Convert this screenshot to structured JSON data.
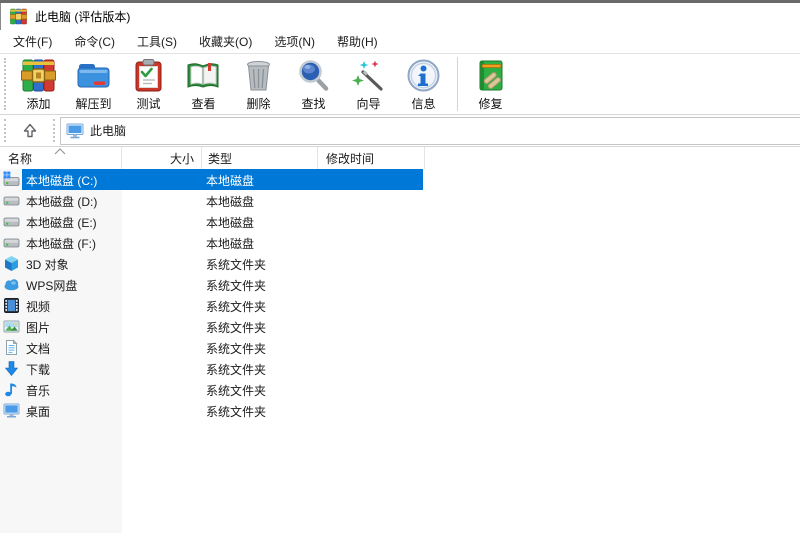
{
  "window": {
    "title": "此电脑 (评估版本)"
  },
  "menu": {
    "items": [
      "文件(F)",
      "命令(C)",
      "工具(S)",
      "收藏夹(O)",
      "选项(N)",
      "帮助(H)"
    ]
  },
  "toolbar": {
    "buttons": [
      {
        "label": "添加",
        "icon": "winrar-archive-icon"
      },
      {
        "label": "解压到",
        "icon": "extract-folder-icon"
      },
      {
        "label": "测试",
        "icon": "test-clipboard-icon"
      },
      {
        "label": "查看",
        "icon": "view-book-icon"
      },
      {
        "label": "删除",
        "icon": "delete-trash-icon"
      },
      {
        "label": "查找",
        "icon": "find-magnifier-icon"
      },
      {
        "label": "向导",
        "icon": "wizard-wand-icon"
      },
      {
        "label": "信息",
        "icon": "info-icon"
      },
      {
        "label": "修复",
        "icon": "repair-book-icon"
      }
    ]
  },
  "addressbar": {
    "location": "此电脑",
    "location_icon": "computer-icon"
  },
  "list": {
    "columns": [
      {
        "label": "名称",
        "sort": "ascending"
      },
      {
        "label": "大小",
        "sort": ""
      },
      {
        "label": "类型",
        "sort": ""
      },
      {
        "label": "修改时间",
        "sort": ""
      }
    ],
    "rows": [
      {
        "name": "本地磁盘 (C:)",
        "size": "",
        "type": "本地磁盘",
        "modified": "",
        "icon": "system-drive-icon",
        "selected": true
      },
      {
        "name": "本地磁盘 (D:)",
        "size": "",
        "type": "本地磁盘",
        "modified": "",
        "icon": "drive-icon",
        "selected": false
      },
      {
        "name": "本地磁盘 (E:)",
        "size": "",
        "type": "本地磁盘",
        "modified": "",
        "icon": "drive-icon",
        "selected": false
      },
      {
        "name": "本地磁盘 (F:)",
        "size": "",
        "type": "本地磁盘",
        "modified": "",
        "icon": "drive-icon",
        "selected": false
      },
      {
        "name": "3D 对象",
        "size": "",
        "type": "系统文件夹",
        "modified": "",
        "icon": "3d-objects-icon",
        "selected": false
      },
      {
        "name": "WPS网盘",
        "size": "",
        "type": "系统文件夹",
        "modified": "",
        "icon": "cloud-icon",
        "selected": false
      },
      {
        "name": "视频",
        "size": "",
        "type": "系统文件夹",
        "modified": "",
        "icon": "videos-icon",
        "selected": false
      },
      {
        "name": "图片",
        "size": "",
        "type": "系统文件夹",
        "modified": "",
        "icon": "pictures-icon",
        "selected": false
      },
      {
        "name": "文档",
        "size": "",
        "type": "系统文件夹",
        "modified": "",
        "icon": "documents-icon",
        "selected": false
      },
      {
        "name": "下载",
        "size": "",
        "type": "系统文件夹",
        "modified": "",
        "icon": "downloads-icon",
        "selected": false
      },
      {
        "name": "音乐",
        "size": "",
        "type": "系统文件夹",
        "modified": "",
        "icon": "music-icon",
        "selected": false
      },
      {
        "name": "桌面",
        "size": "",
        "type": "系统文件夹",
        "modified": "",
        "icon": "desktop-icon",
        "selected": false
      }
    ]
  },
  "colors": {
    "selection_blue": "#0078d7",
    "selected_text": "#ffffff",
    "sorted_column_tint": "#f7f7f7"
  }
}
